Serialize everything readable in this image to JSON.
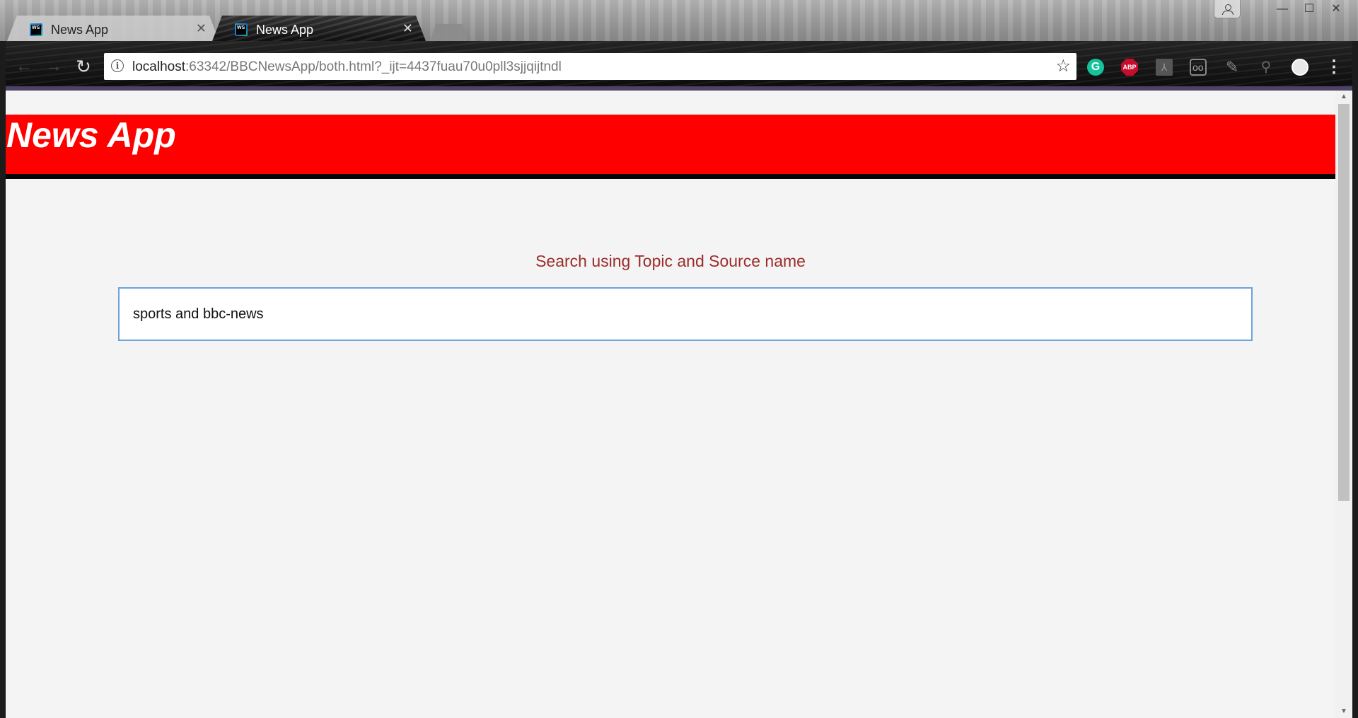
{
  "tabs": [
    {
      "title": "News App",
      "close": "✕"
    },
    {
      "title": "News App",
      "close": "✕"
    }
  ],
  "window_controls": {
    "minimize": "—",
    "maximize": "☐",
    "close": "✕"
  },
  "toolbar": {
    "back": "←",
    "forward": "→",
    "reload": "↻",
    "url_host": "localhost",
    "url_rest": ":63342/BBCNewsApp/both.html?_ijt=4437fuau70u0pll3sjjqijtndl",
    "info": "i",
    "bookmark": "☆"
  },
  "extensions": [
    {
      "icon": "grammarly-icon",
      "glyph": "G",
      "color": "#15c39a"
    },
    {
      "icon": "adblock-plus-icon",
      "glyph": "ABP",
      "color": "#c70d2c"
    },
    {
      "icon": "pdf-icon",
      "glyph": "⅄"
    },
    {
      "icon": "glasses-icon",
      "glyph": ""
    },
    {
      "icon": "pen-icon",
      "glyph": "✎"
    },
    {
      "icon": "magnifier-icon",
      "glyph": "⚲"
    },
    {
      "icon": "circle-extension-icon",
      "glyph": ""
    },
    {
      "icon": "menu-icon",
      "glyph": "⋮"
    }
  ],
  "page": {
    "title": "News App",
    "search_label": "Search using Topic and Source name",
    "search_value": "sports and bbc-news"
  },
  "colors": {
    "header_bg": "#ff0000",
    "header_text": "#ffffff",
    "label_text": "#9b2b2b",
    "input_border": "#6ea2dc",
    "page_bg": "#f4f4f4"
  },
  "scrollbar": {
    "up": "▲",
    "down": "▼"
  }
}
